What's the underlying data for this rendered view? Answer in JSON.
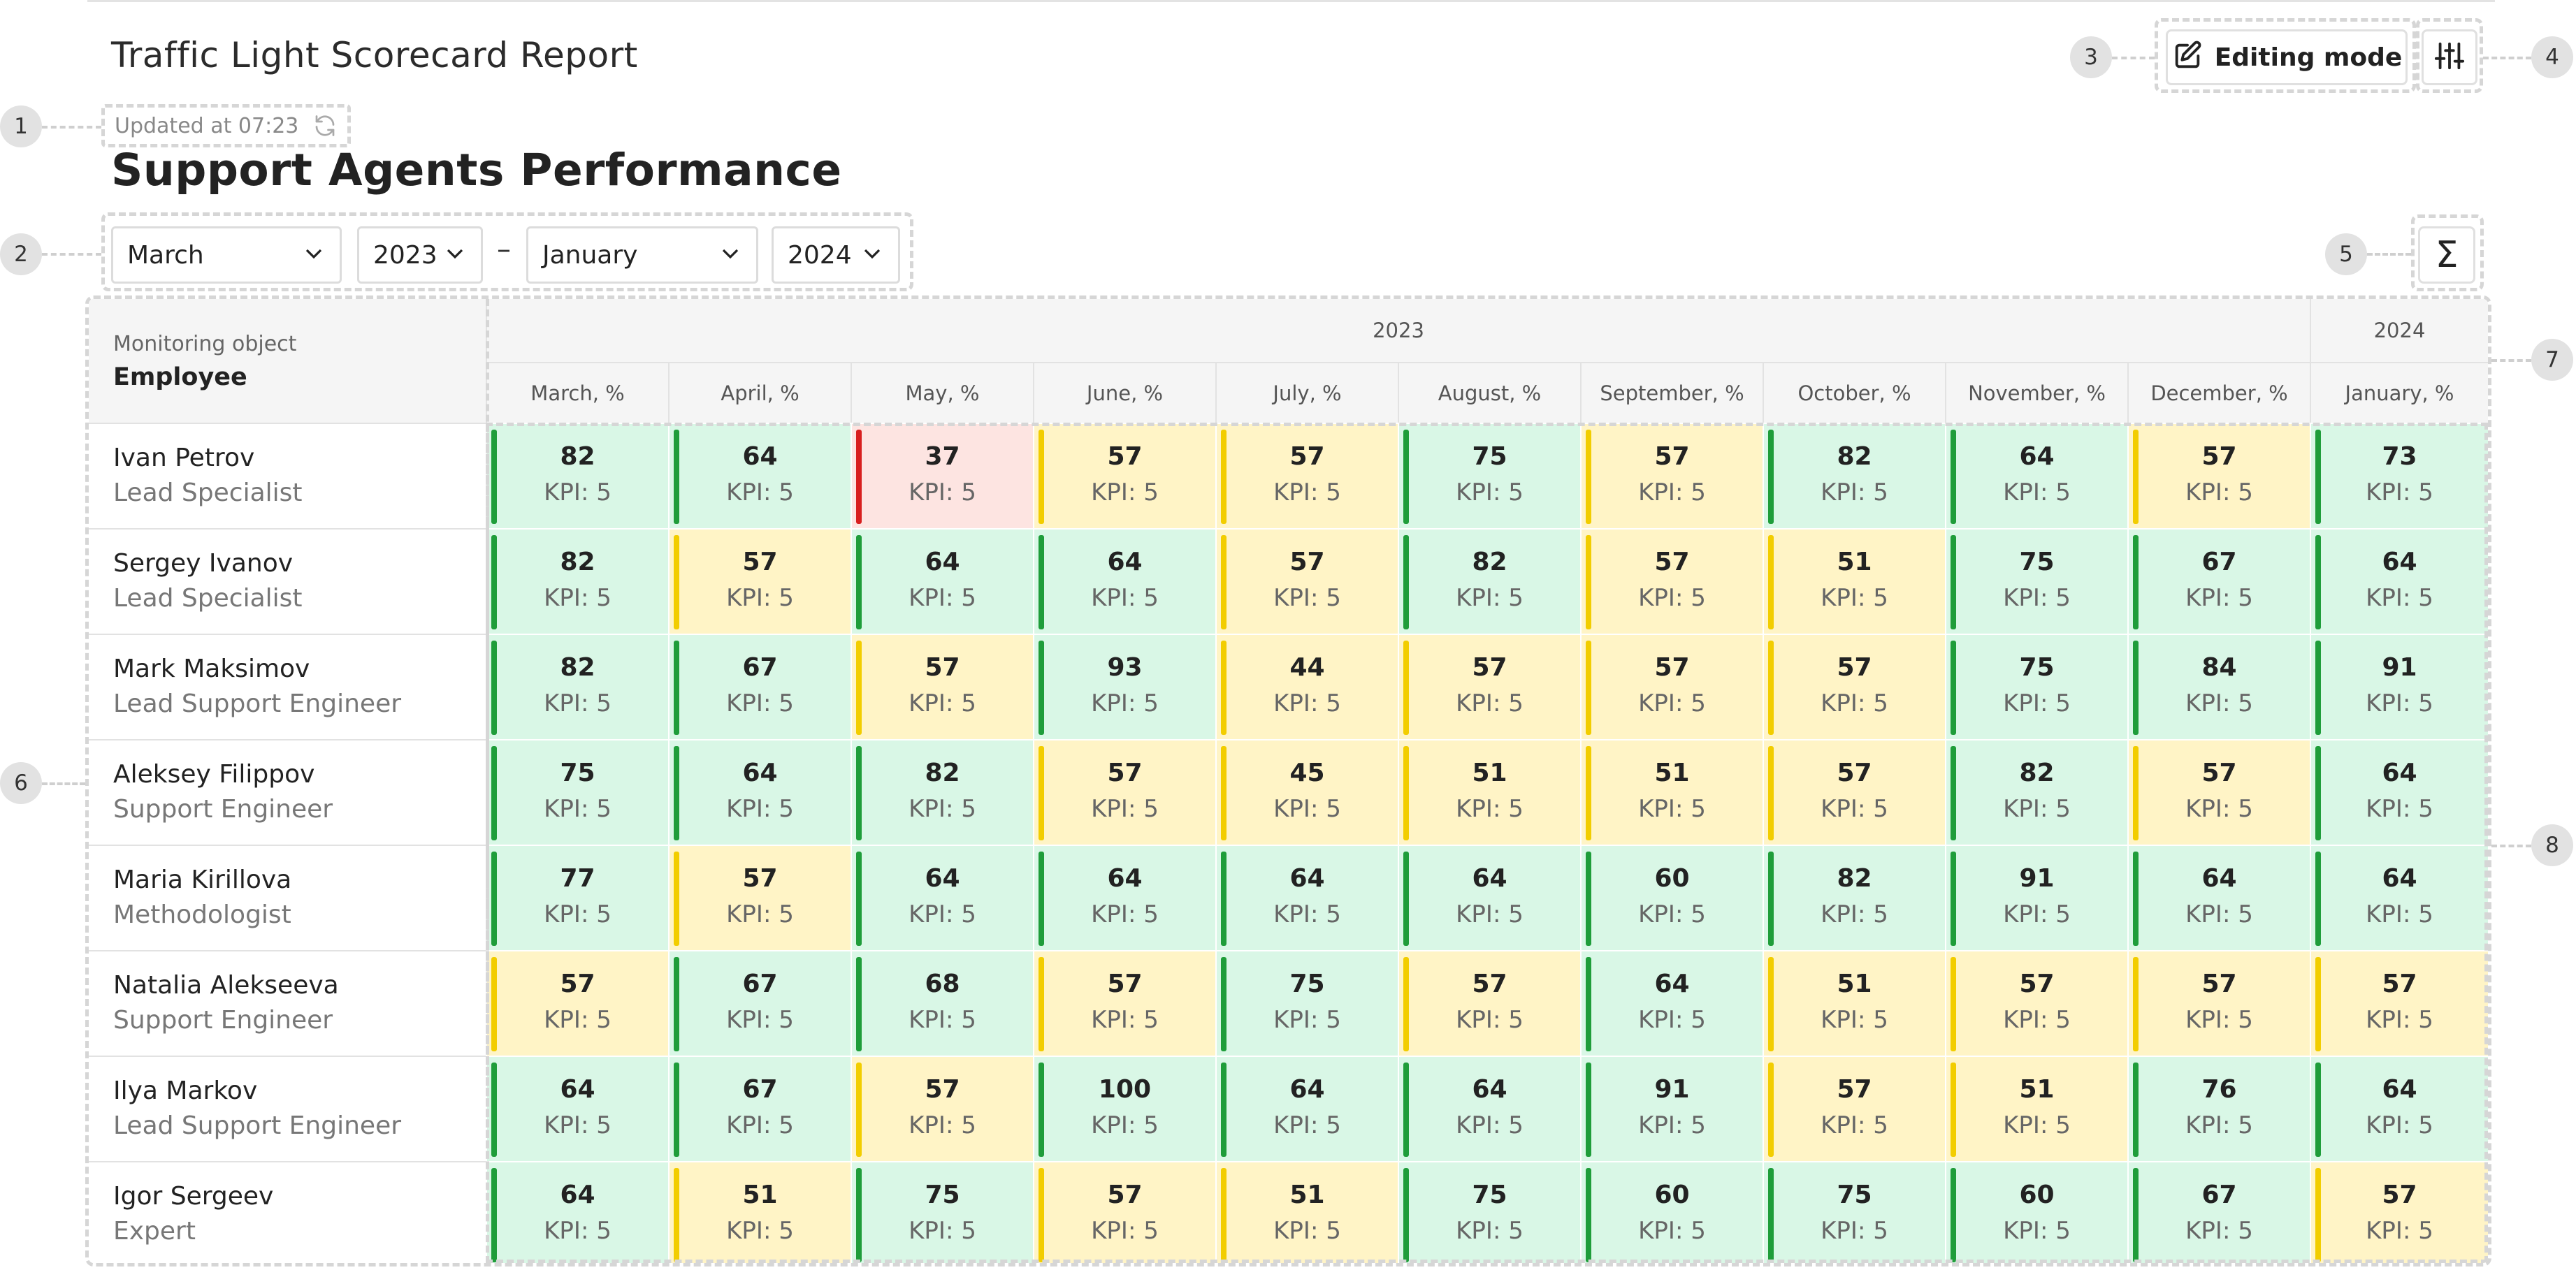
{
  "header": {
    "report_title": "Traffic Light Scorecard Report",
    "updated_text": "Updated at 07:23",
    "page_title": "Support Agents Performance",
    "editing_mode_label": "Editing mode"
  },
  "filters": {
    "from_month": "March",
    "from_year": "2023",
    "separator": "–",
    "to_month": "January",
    "to_year": "2024"
  },
  "callouts": [
    "1",
    "2",
    "3",
    "4",
    "5",
    "6",
    "7",
    "8"
  ],
  "table": {
    "object_label": "Monitoring object",
    "object_title": "Employee",
    "years": [
      {
        "label": "2023",
        "span": 10
      },
      {
        "label": "2024",
        "span": 1
      }
    ],
    "columns": [
      "March, %",
      "April, %",
      "May, %",
      "June, %",
      "July, %",
      "August, %",
      "September, %",
      "October, %",
      "November, %",
      "December, %",
      "January, %"
    ],
    "kpi_label": "KPI: 5",
    "status_colors": {
      "green": "#1f9d3a",
      "yellow": "#f2cd00",
      "red": "#d81f1f"
    },
    "rows": [
      {
        "name": "Ivan Petrov",
        "role": "Lead Specialist",
        "values": [
          "82",
          "64",
          "37",
          "57",
          "57",
          "75",
          "57",
          "82",
          "64",
          "57",
          "73"
        ],
        "status": [
          "green",
          "green",
          "red",
          "yellow",
          "yellow",
          "green",
          "yellow",
          "green",
          "green",
          "yellow",
          "green"
        ]
      },
      {
        "name": "Sergey Ivanov",
        "role": "Lead Specialist",
        "values": [
          "82",
          "57",
          "64",
          "64",
          "57",
          "82",
          "57",
          "51",
          "75",
          "67",
          "64"
        ],
        "status": [
          "green",
          "yellow",
          "green",
          "green",
          "yellow",
          "green",
          "yellow",
          "yellow",
          "green",
          "green",
          "green"
        ]
      },
      {
        "name": "Mark Maksimov",
        "role": "Lead Support Engineer",
        "values": [
          "82",
          "67",
          "57",
          "93",
          "44",
          "57",
          "57",
          "57",
          "75",
          "84",
          "91"
        ],
        "status": [
          "green",
          "green",
          "yellow",
          "green",
          "yellow",
          "yellow",
          "yellow",
          "yellow",
          "green",
          "green",
          "green"
        ]
      },
      {
        "name": "Aleksey Filippov",
        "role": "Support Engineer",
        "values": [
          "75",
          "64",
          "82",
          "57",
          "45",
          "51",
          "51",
          "57",
          "82",
          "57",
          "64"
        ],
        "status": [
          "green",
          "green",
          "green",
          "yellow",
          "yellow",
          "yellow",
          "yellow",
          "yellow",
          "green",
          "yellow",
          "green"
        ]
      },
      {
        "name": "Maria Kirillova",
        "role": "Methodologist",
        "values": [
          "77",
          "57",
          "64",
          "64",
          "64",
          "64",
          "60",
          "82",
          "91",
          "64",
          "64"
        ],
        "status": [
          "green",
          "yellow",
          "green",
          "green",
          "green",
          "green",
          "green",
          "green",
          "green",
          "green",
          "green"
        ]
      },
      {
        "name": "Natalia Alekseeva",
        "role": "Support Engineer",
        "values": [
          "57",
          "67",
          "68",
          "57",
          "75",
          "57",
          "64",
          "51",
          "57",
          "57",
          "57"
        ],
        "status": [
          "yellow",
          "green",
          "green",
          "yellow",
          "green",
          "yellow",
          "green",
          "yellow",
          "yellow",
          "yellow",
          "yellow"
        ]
      },
      {
        "name": "Ilya Markov",
        "role": "Lead Support Engineer",
        "values": [
          "64",
          "67",
          "57",
          "100",
          "64",
          "64",
          "91",
          "57",
          "51",
          "76",
          "64"
        ],
        "status": [
          "green",
          "green",
          "yellow",
          "green",
          "green",
          "green",
          "green",
          "yellow",
          "yellow",
          "green",
          "green"
        ]
      },
      {
        "name": "Igor Sergeev",
        "role": "Expert",
        "values": [
          "64",
          "51",
          "75",
          "57",
          "51",
          "75",
          "60",
          "75",
          "60",
          "67",
          "57"
        ],
        "status": [
          "green",
          "yellow",
          "green",
          "yellow",
          "yellow",
          "green",
          "green",
          "green",
          "green",
          "green",
          "yellow"
        ]
      }
    ]
  }
}
